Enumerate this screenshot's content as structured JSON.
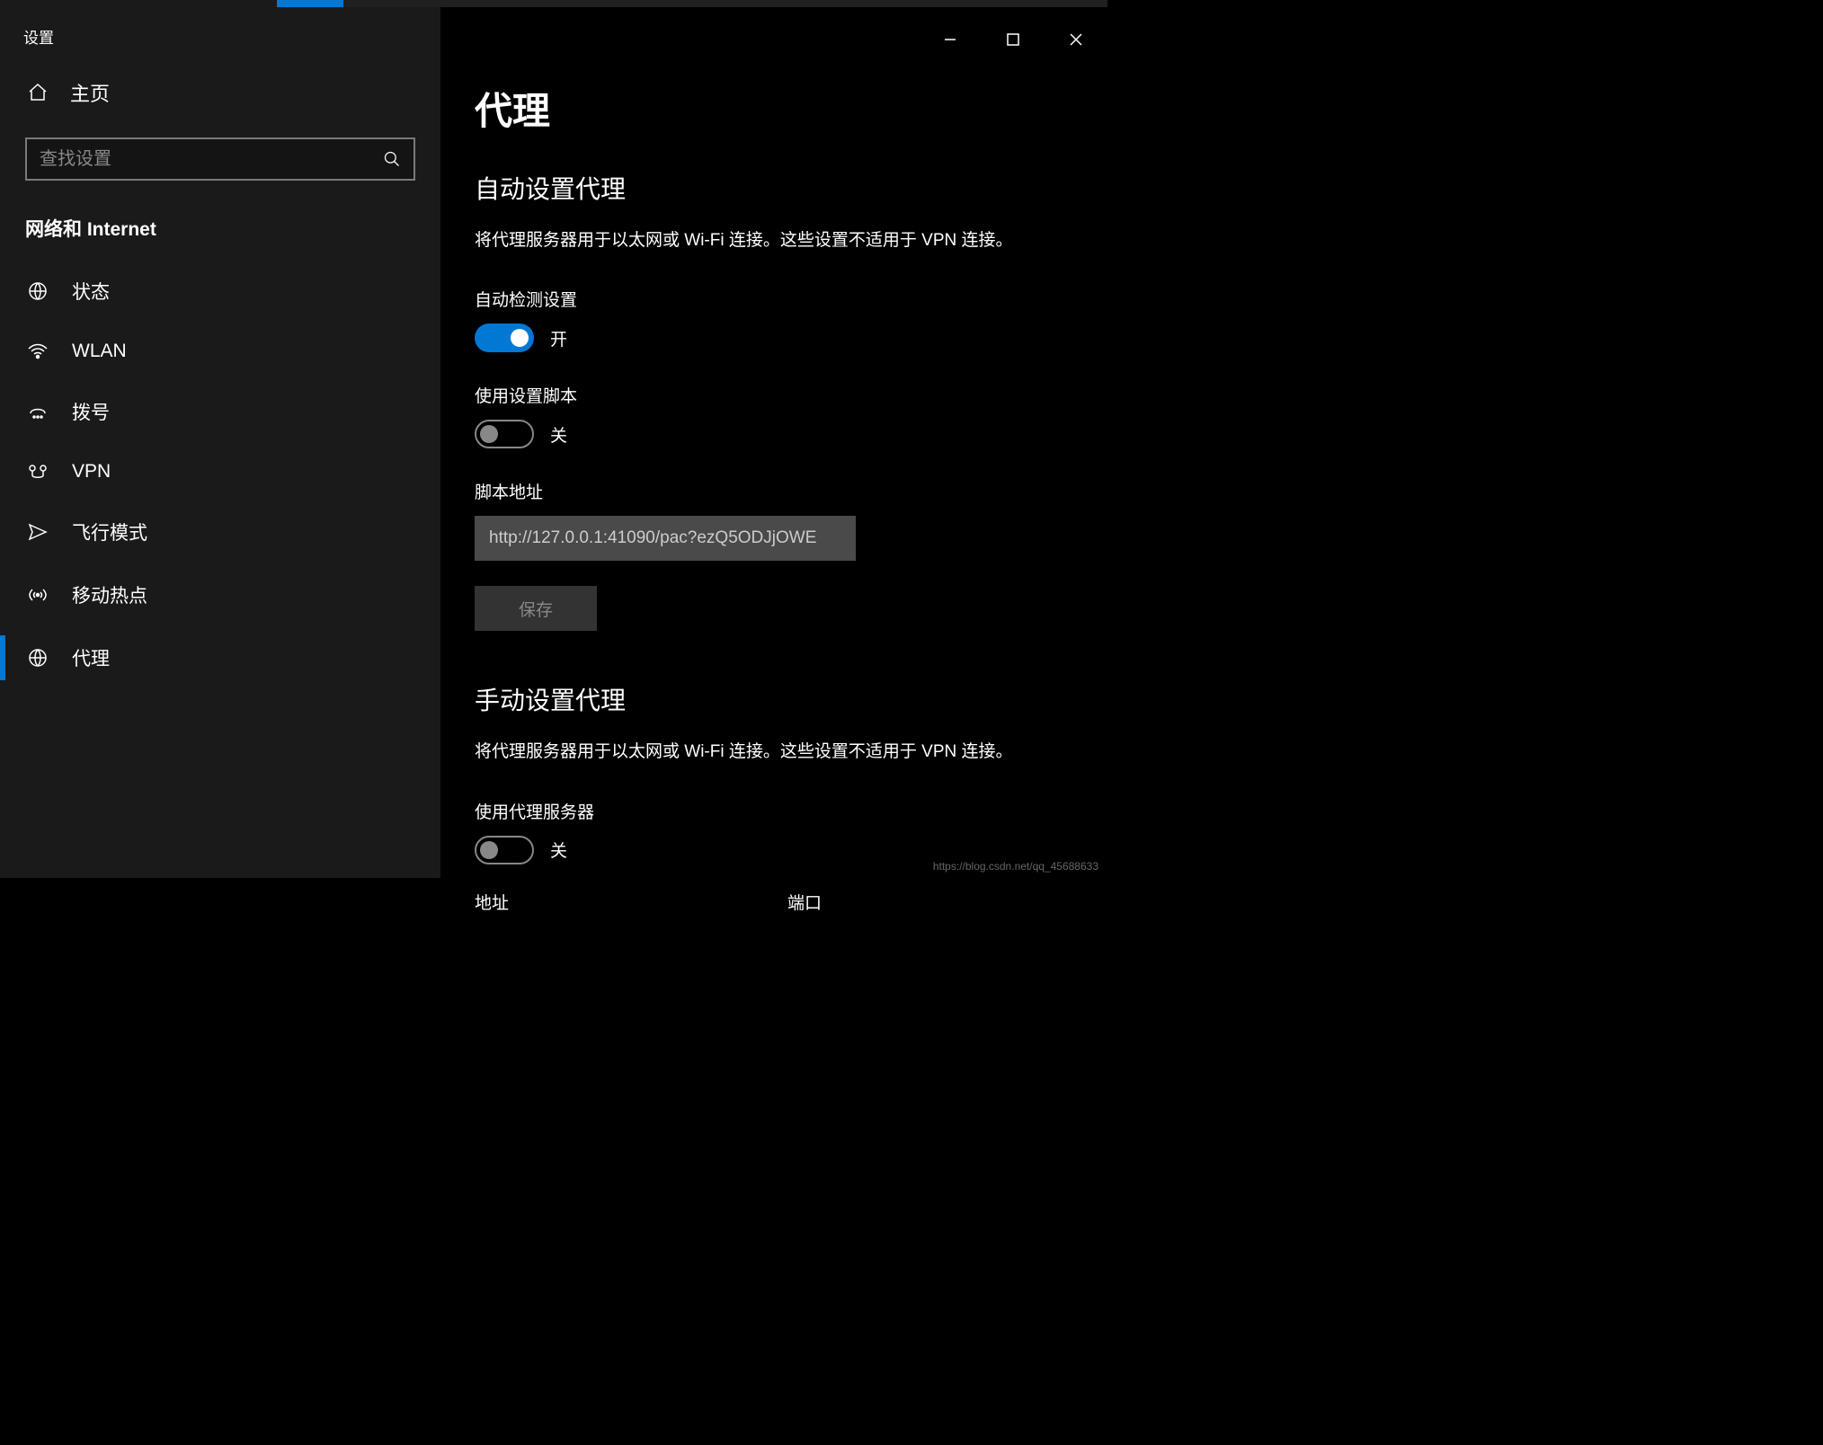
{
  "app_title": "设置",
  "home_label": "主页",
  "search": {
    "placeholder": "查找设置"
  },
  "category": "网络和 Internet",
  "sidebar": {
    "items": [
      {
        "label": "状态",
        "icon": "status-icon"
      },
      {
        "label": "WLAN",
        "icon": "wifi-icon"
      },
      {
        "label": "拨号",
        "icon": "dialup-icon"
      },
      {
        "label": "VPN",
        "icon": "vpn-icon"
      },
      {
        "label": "飞行模式",
        "icon": "airplane-icon"
      },
      {
        "label": "移动热点",
        "icon": "hotspot-icon"
      },
      {
        "label": "代理",
        "icon": "proxy-icon"
      }
    ],
    "active_index": 6
  },
  "main": {
    "page_title": "代理",
    "auto": {
      "title": "自动设置代理",
      "desc": "将代理服务器用于以太网或 Wi-Fi 连接。这些设置不适用于 VPN 连接。",
      "auto_detect_label": "自动检测设置",
      "auto_detect_state": "开",
      "auto_detect_on": true,
      "use_script_label": "使用设置脚本",
      "use_script_state": "关",
      "use_script_on": false,
      "script_address_label": "脚本地址",
      "script_address_value": "http://127.0.0.1:41090/pac?ezQ5ODJjOWE",
      "save_label": "保存"
    },
    "manual": {
      "title": "手动设置代理",
      "desc": "将代理服务器用于以太网或 Wi-Fi 连接。这些设置不适用于 VPN 连接。",
      "use_proxy_label": "使用代理服务器",
      "use_proxy_state": "关",
      "use_proxy_on": false,
      "address_label": "地址",
      "port_label": "端口"
    }
  },
  "watermark": "https://blog.csdn.net/qq_45688633"
}
